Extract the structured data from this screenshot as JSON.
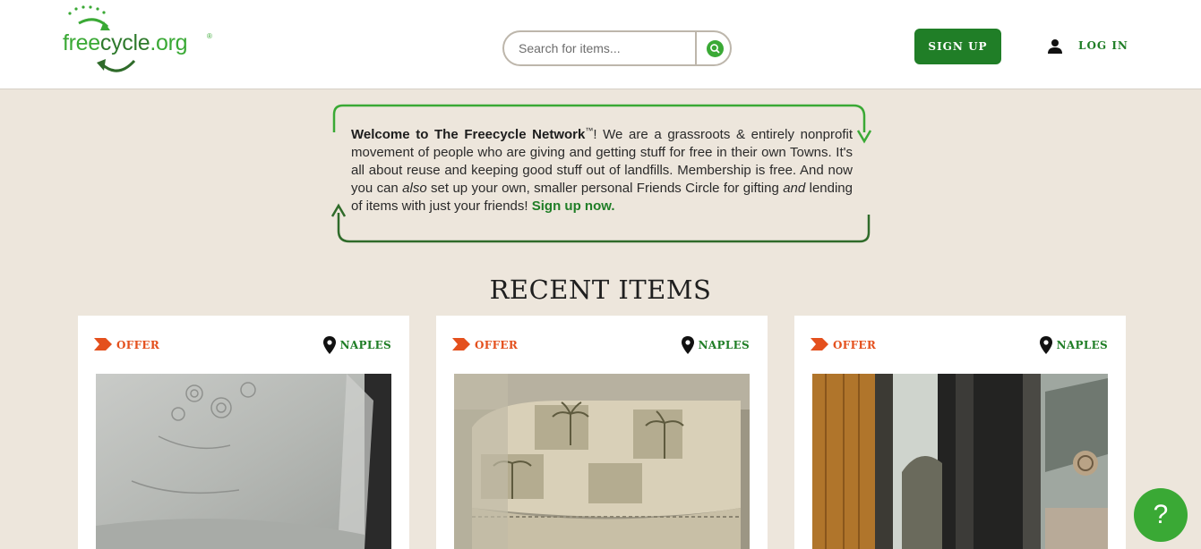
{
  "header": {
    "logo": {
      "free": "free",
      "cycle": "cycle",
      "org": ".org",
      "reg": "®"
    },
    "search": {
      "placeholder": "Search for items..."
    },
    "signup_label": "SIGN UP",
    "login_label": "LOG IN"
  },
  "welcome": {
    "bold_lead": "Welcome to The Freecycle Network",
    "tm": "™",
    "part1": "! We are a grassroots & entirely nonprofit movement of people who are giving and getting stuff for free in their own Towns. It's all about reuse and keeping good stuff out of landfills. Membership is free. And now you can ",
    "also": "also",
    "part2": " set up your own, smaller personal Friends Circle for gifting ",
    "and": "and",
    "part3": " lending of items with just your friends! ",
    "cta": "Sign up now."
  },
  "recent": {
    "title": "RECENT ITEMS",
    "items": [
      {
        "type": "OFFER",
        "location": "NAPLES"
      },
      {
        "type": "OFFER",
        "location": "NAPLES"
      },
      {
        "type": "OFFER",
        "location": "NAPLES"
      }
    ]
  },
  "help_label": "?",
  "colors": {
    "brand_green": "#207e27",
    "light_green": "#3aa935",
    "offer_orange": "#e4501d",
    "background": "#ede6dc"
  },
  "icons": [
    "recycle-logo-icon",
    "search-icon",
    "user-icon",
    "offer-arrow-icon",
    "map-pin-icon",
    "help-icon"
  ]
}
